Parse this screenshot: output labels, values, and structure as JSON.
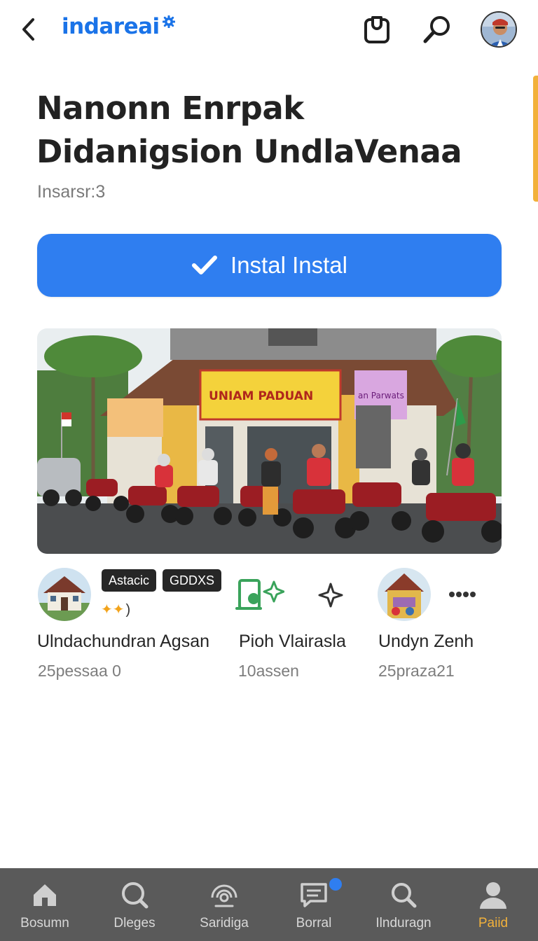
{
  "header": {
    "brand": "indareai",
    "back_icon": "chevron-left-icon",
    "clipboard_icon": "clipboard-icon",
    "search_icon": "search-icon",
    "avatar_icon": "user-avatar"
  },
  "app": {
    "title_line1": "Nanonn Enrpak",
    "title_line2": "Didanigsion UndlaVenaa",
    "subtitle": "Insarsr:3",
    "install_label": "Instal Instal",
    "install_icon": "checkmark-icon"
  },
  "hero": {
    "signs": [
      "UNIAM PADUAN",
      "an Parwats"
    ]
  },
  "related": [
    {
      "name": "Ulndachundran Agsan",
      "meta": "25pessaa 0",
      "badges": [
        "Astacic",
        "GDDXS"
      ],
      "sparkles": "✦✦",
      "paren": ")"
    },
    {
      "name": "Pioh Vlairasla",
      "meta": "10assen",
      "icon": "device-add-icon",
      "extra_icon": "sparkle-icon"
    },
    {
      "name": "Undyn Zenh",
      "meta": "25praza21",
      "more_icon": "more-icon"
    }
  ],
  "nav": {
    "items": [
      {
        "label": "Bosumn",
        "icon": "home-icon"
      },
      {
        "label": "Dleges",
        "icon": "search-icon"
      },
      {
        "label": "Saridiga",
        "icon": "broadcast-icon"
      },
      {
        "label": "Borral",
        "icon": "message-icon"
      },
      {
        "label": "Ilnduragn",
        "icon": "search-icon"
      },
      {
        "label": "Paiid",
        "icon": "person-icon"
      }
    ],
    "active_index": 5
  },
  "colors": {
    "brand_blue": "#1a73e8",
    "install_blue": "#2f7ef0",
    "accent_orange": "#f2b13b",
    "nav_bg": "#5a5a5a",
    "badge_bg": "#262626"
  }
}
